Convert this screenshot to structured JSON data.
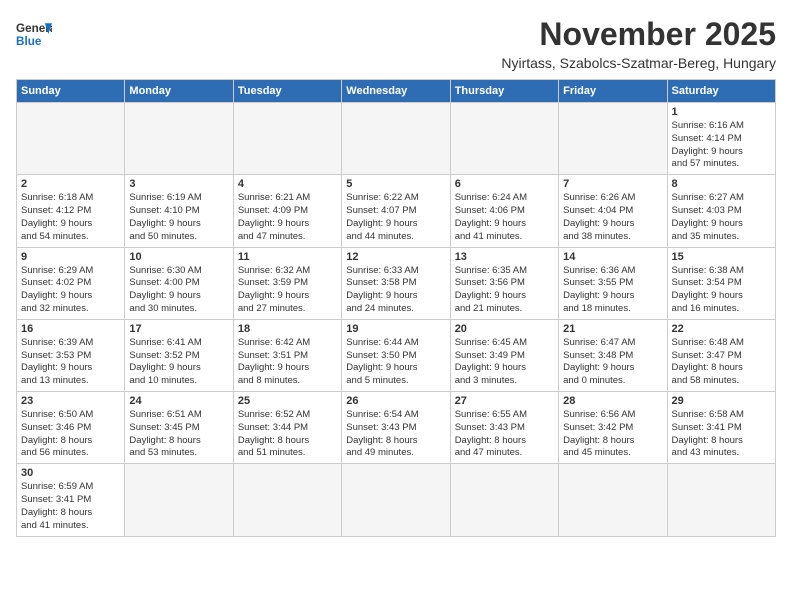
{
  "header": {
    "logo_general": "General",
    "logo_blue": "Blue",
    "month_title": "November 2025",
    "location": "Nyirtass, Szabolcs-Szatmar-Bereg, Hungary"
  },
  "weekdays": [
    "Sunday",
    "Monday",
    "Tuesday",
    "Wednesday",
    "Thursday",
    "Friday",
    "Saturday"
  ],
  "weeks": [
    [
      {
        "day": "",
        "info": ""
      },
      {
        "day": "",
        "info": ""
      },
      {
        "day": "",
        "info": ""
      },
      {
        "day": "",
        "info": ""
      },
      {
        "day": "",
        "info": ""
      },
      {
        "day": "",
        "info": ""
      },
      {
        "day": "1",
        "info": "Sunrise: 6:16 AM\nSunset: 4:14 PM\nDaylight: 9 hours\nand 57 minutes."
      }
    ],
    [
      {
        "day": "2",
        "info": "Sunrise: 6:18 AM\nSunset: 4:12 PM\nDaylight: 9 hours\nand 54 minutes."
      },
      {
        "day": "3",
        "info": "Sunrise: 6:19 AM\nSunset: 4:10 PM\nDaylight: 9 hours\nand 50 minutes."
      },
      {
        "day": "4",
        "info": "Sunrise: 6:21 AM\nSunset: 4:09 PM\nDaylight: 9 hours\nand 47 minutes."
      },
      {
        "day": "5",
        "info": "Sunrise: 6:22 AM\nSunset: 4:07 PM\nDaylight: 9 hours\nand 44 minutes."
      },
      {
        "day": "6",
        "info": "Sunrise: 6:24 AM\nSunset: 4:06 PM\nDaylight: 9 hours\nand 41 minutes."
      },
      {
        "day": "7",
        "info": "Sunrise: 6:26 AM\nSunset: 4:04 PM\nDaylight: 9 hours\nand 38 minutes."
      },
      {
        "day": "8",
        "info": "Sunrise: 6:27 AM\nSunset: 4:03 PM\nDaylight: 9 hours\nand 35 minutes."
      }
    ],
    [
      {
        "day": "9",
        "info": "Sunrise: 6:29 AM\nSunset: 4:02 PM\nDaylight: 9 hours\nand 32 minutes."
      },
      {
        "day": "10",
        "info": "Sunrise: 6:30 AM\nSunset: 4:00 PM\nDaylight: 9 hours\nand 30 minutes."
      },
      {
        "day": "11",
        "info": "Sunrise: 6:32 AM\nSunset: 3:59 PM\nDaylight: 9 hours\nand 27 minutes."
      },
      {
        "day": "12",
        "info": "Sunrise: 6:33 AM\nSunset: 3:58 PM\nDaylight: 9 hours\nand 24 minutes."
      },
      {
        "day": "13",
        "info": "Sunrise: 6:35 AM\nSunset: 3:56 PM\nDaylight: 9 hours\nand 21 minutes."
      },
      {
        "day": "14",
        "info": "Sunrise: 6:36 AM\nSunset: 3:55 PM\nDaylight: 9 hours\nand 18 minutes."
      },
      {
        "day": "15",
        "info": "Sunrise: 6:38 AM\nSunset: 3:54 PM\nDaylight: 9 hours\nand 16 minutes."
      }
    ],
    [
      {
        "day": "16",
        "info": "Sunrise: 6:39 AM\nSunset: 3:53 PM\nDaylight: 9 hours\nand 13 minutes."
      },
      {
        "day": "17",
        "info": "Sunrise: 6:41 AM\nSunset: 3:52 PM\nDaylight: 9 hours\nand 10 minutes."
      },
      {
        "day": "18",
        "info": "Sunrise: 6:42 AM\nSunset: 3:51 PM\nDaylight: 9 hours\nand 8 minutes."
      },
      {
        "day": "19",
        "info": "Sunrise: 6:44 AM\nSunset: 3:50 PM\nDaylight: 9 hours\nand 5 minutes."
      },
      {
        "day": "20",
        "info": "Sunrise: 6:45 AM\nSunset: 3:49 PM\nDaylight: 9 hours\nand 3 minutes."
      },
      {
        "day": "21",
        "info": "Sunrise: 6:47 AM\nSunset: 3:48 PM\nDaylight: 9 hours\nand 0 minutes."
      },
      {
        "day": "22",
        "info": "Sunrise: 6:48 AM\nSunset: 3:47 PM\nDaylight: 8 hours\nand 58 minutes."
      }
    ],
    [
      {
        "day": "23",
        "info": "Sunrise: 6:50 AM\nSunset: 3:46 PM\nDaylight: 8 hours\nand 56 minutes."
      },
      {
        "day": "24",
        "info": "Sunrise: 6:51 AM\nSunset: 3:45 PM\nDaylight: 8 hours\nand 53 minutes."
      },
      {
        "day": "25",
        "info": "Sunrise: 6:52 AM\nSunset: 3:44 PM\nDaylight: 8 hours\nand 51 minutes."
      },
      {
        "day": "26",
        "info": "Sunrise: 6:54 AM\nSunset: 3:43 PM\nDaylight: 8 hours\nand 49 minutes."
      },
      {
        "day": "27",
        "info": "Sunrise: 6:55 AM\nSunset: 3:43 PM\nDaylight: 8 hours\nand 47 minutes."
      },
      {
        "day": "28",
        "info": "Sunrise: 6:56 AM\nSunset: 3:42 PM\nDaylight: 8 hours\nand 45 minutes."
      },
      {
        "day": "29",
        "info": "Sunrise: 6:58 AM\nSunset: 3:41 PM\nDaylight: 8 hours\nand 43 minutes."
      }
    ],
    [
      {
        "day": "30",
        "info": "Sunrise: 6:59 AM\nSunset: 3:41 PM\nDaylight: 8 hours\nand 41 minutes."
      },
      {
        "day": "",
        "info": ""
      },
      {
        "day": "",
        "info": ""
      },
      {
        "day": "",
        "info": ""
      },
      {
        "day": "",
        "info": ""
      },
      {
        "day": "",
        "info": ""
      },
      {
        "day": "",
        "info": ""
      }
    ]
  ]
}
